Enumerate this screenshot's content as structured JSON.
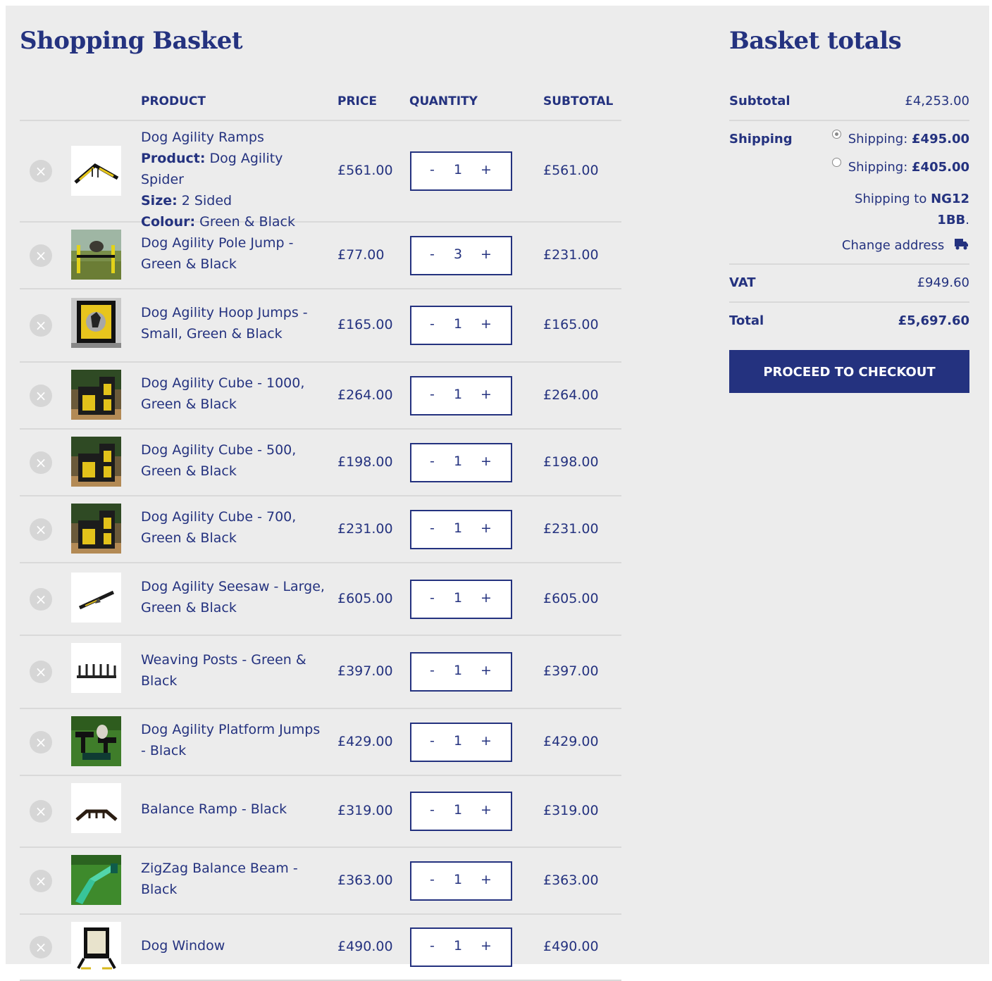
{
  "basket": {
    "title": "Shopping Basket",
    "columns": {
      "product": "PRODUCT",
      "price": "PRICE",
      "quantity": "QUANTITY",
      "subtotal": "SUBTOTAL"
    },
    "remove_symbol": "×",
    "qty_minus": "-",
    "qty_plus": "+",
    "items": [
      {
        "name": "Dog Agility Ramps",
        "meta": [
          {
            "label": "Product:",
            "value": "Dog Agility Spider"
          },
          {
            "label": "Size:",
            "value": "2 Sided"
          },
          {
            "label": "Colour:",
            "value": "Green & Black"
          }
        ],
        "price": "£561.00",
        "quantity": "1",
        "subtotal": "£561.00",
        "thumb": "ramp-icon"
      },
      {
        "name": "Dog Agility Pole Jump - Green & Black",
        "price": "£77.00",
        "quantity": "3",
        "subtotal": "£231.00",
        "thumb": "pole-jump-photo"
      },
      {
        "name": "Dog Agility Hoop Jumps - Small, Green & Black",
        "price": "£165.00",
        "quantity": "1",
        "subtotal": "£165.00",
        "thumb": "hoop-jump-photo"
      },
      {
        "name": "Dog Agility Cube - 1000, Green & Black",
        "price": "£264.00",
        "quantity": "1",
        "subtotal": "£264.00",
        "thumb": "cube-photo"
      },
      {
        "name": "Dog Agility Cube - 500, Green & Black",
        "price": "£198.00",
        "quantity": "1",
        "subtotal": "£198.00",
        "thumb": "cube-photo"
      },
      {
        "name": "Dog Agility Cube - 700, Green & Black",
        "price": "£231.00",
        "quantity": "1",
        "subtotal": "£231.00",
        "thumb": "cube-photo"
      },
      {
        "name": "Dog Agility Seesaw - Large, Green & Black",
        "price": "£605.00",
        "quantity": "1",
        "subtotal": "£605.00",
        "thumb": "seesaw-icon"
      },
      {
        "name": "Weaving Posts - Green & Black",
        "price": "£397.00",
        "quantity": "1",
        "subtotal": "£397.00",
        "thumb": "weave-posts-icon"
      },
      {
        "name": "Dog Agility Platform Jumps - Black",
        "price": "£429.00",
        "quantity": "1",
        "subtotal": "£429.00",
        "thumb": "platform-photo"
      },
      {
        "name": "Balance Ramp - Black",
        "price": "£319.00",
        "quantity": "1",
        "subtotal": "£319.00",
        "thumb": "balance-ramp-icon"
      },
      {
        "name": "ZigZag Balance Beam - Black",
        "price": "£363.00",
        "quantity": "1",
        "subtotal": "£363.00",
        "thumb": "zigzag-beam-photo"
      },
      {
        "name": "Dog Window",
        "price": "£490.00",
        "quantity": "1",
        "subtotal": "£490.00",
        "thumb": "dog-window-icon"
      }
    ]
  },
  "totals": {
    "title": "Basket totals",
    "subtotal_label": "Subtotal",
    "subtotal_value": "£4,253.00",
    "shipping_label": "Shipping",
    "shipping_options": [
      {
        "label": "Shipping:",
        "price": "£495.00",
        "selected": true
      },
      {
        "label": "Shipping:",
        "price": "£405.00",
        "selected": false
      }
    ],
    "shipping_to_prefix": "Shipping to",
    "shipping_to_line1": "NG12",
    "shipping_to_line2": "1BB",
    "change_address": "Change address",
    "vat_label": "VAT",
    "vat_value": "£949.60",
    "total_label": "Total",
    "total_value": "£5,697.60",
    "checkout_label": "PROCEED TO CHECKOUT"
  },
  "colors": {
    "brand": "#24327f",
    "background": "#ececec",
    "divider": "#d9d9d9"
  }
}
